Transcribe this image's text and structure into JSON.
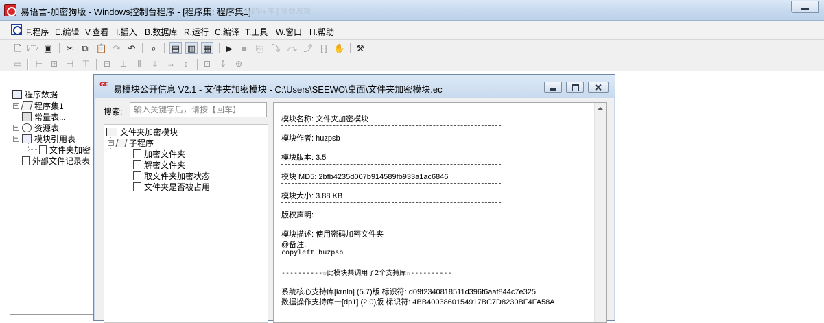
{
  "main_window": {
    "title": "易语言-加密狗版 - Windows控制台程序 - [程序集: 程序集1]",
    "ghost_title": "我的程序 [  猜数游戏"
  },
  "menu": [
    "F.程序",
    "E.编辑",
    "V.查看",
    "I.插入",
    "B.数据库",
    "R.运行",
    "C.编译",
    "T.工具",
    "W.窗口",
    "H.帮助"
  ],
  "toolbar1_icons": [
    "new-file-icon",
    "open-folder-icon",
    "save-icon",
    "cut-icon",
    "copy-icon",
    "paste-icon",
    "redo-icon",
    "undo-icon",
    "find-icon",
    "layout1-icon",
    "layout2-icon",
    "layout3-icon",
    "run-icon",
    "stop-icon",
    "step-icon",
    "step-into-icon",
    "step-over-icon",
    "step-out-icon",
    "breakpoint-icon",
    "hand-icon",
    "debug-tool-icon"
  ],
  "toolbar2_icons": [
    "align-form-icon",
    "align-left-icon",
    "align-center-icon",
    "align-right-icon",
    "align-top-icon",
    "align-middle-icon",
    "align-bottom-icon",
    "distribute-h-icon",
    "distribute-v-icon",
    "same-width-icon",
    "same-height-icon",
    "same-size-icon"
  ],
  "project_tree": {
    "root": "程序数据",
    "items": [
      {
        "label": "程序集1",
        "expander": "+"
      },
      {
        "label": "常量表...",
        "expander": ""
      },
      {
        "label": "资源表",
        "expander": "+"
      },
      {
        "label": "模块引用表",
        "expander": "−"
      },
      {
        "label": "文件夹加密",
        "expander": ""
      },
      {
        "label": "外部文件记录表",
        "expander": ""
      }
    ]
  },
  "dialog": {
    "title": "易模块公开信息 V2.1 - 文件夹加密模块 - C:\\Users\\SEEWO\\桌面\\文件夹加密模块.ec",
    "icon_text": "GE",
    "search_label": "搜索:",
    "search_placeholder": "输入关键字后，请按【回车】",
    "tree": {
      "root": "文件夹加密模块",
      "group": "子程序",
      "items": [
        "加密文件夹",
        "解密文件夹",
        "取文件夹加密状态",
        "文件夹是否被占用"
      ]
    },
    "info": {
      "name_line": "模块名称: 文件夹加密模块",
      "author_line": "模块作者: huzpsb",
      "version_line": "模块版本: 3.5",
      "md5_line": "模块 MD5: 2bfb4235d007b914589fb933a1ac6846",
      "size_line": "模块大小: 3.88 KB",
      "copyright_line": "版权声明:",
      "desc_line": "模块描述: 使用密码加密文件夹",
      "remark_line": "@备注:",
      "copyleft_line": "copyleft huzpsb",
      "lib_header": "----------☆此模块共调用了2个支持库☆----------",
      "lib1": "系统核心支持库[krnln] (5.7)版 标识符: d09f2340818511d396f6aaf844c7e325",
      "lib2": "数据操作支持库一[dp1] (2.0)版 标识符: 4BB4003860154917BC7D8230BF4FA58A"
    }
  }
}
